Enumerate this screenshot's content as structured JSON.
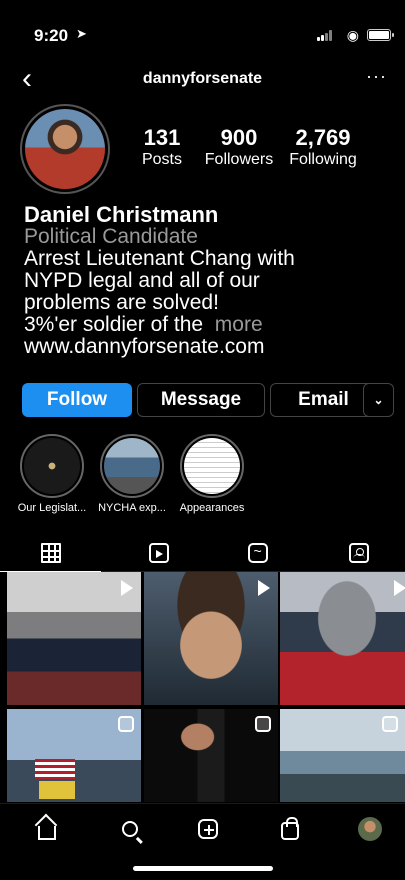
{
  "status": {
    "time": "9:20",
    "location_icon": "location-arrow-icon"
  },
  "header": {
    "back_icon": "chevron-left-icon",
    "username": "dannyforsenate",
    "more_label": "···"
  },
  "stats": {
    "posts": {
      "value": "131",
      "label": "Posts"
    },
    "followers": {
      "value": "900",
      "label": "Followers"
    },
    "following": {
      "value": "2,769",
      "label": "Following"
    }
  },
  "bio": {
    "name": "Daniel Christmann",
    "category": "Political Candidate",
    "line1": "Arrest Lieutenant Chang with",
    "line2": "NYPD legal and all of our",
    "line3": "problems are solved!",
    "line4": "3%'er soldier of the",
    "more": "more",
    "link": "www.dannyforsenate.com"
  },
  "actions": {
    "follow": "Follow",
    "message": "Message",
    "email": "Email",
    "chevron": "⌄"
  },
  "highlights": [
    {
      "label": "Our Legislat..."
    },
    {
      "label": "NYCHA exp..."
    },
    {
      "label": "Appearances"
    }
  ],
  "tabs": [
    "grid-icon",
    "reels-icon",
    "igtv-icon",
    "tagged-icon"
  ],
  "nav": [
    "home-icon",
    "search-icon",
    "new-post-icon",
    "shop-icon",
    "profile-avatar"
  ],
  "colors": {
    "accent": "#1d8ff0",
    "background": "#000000",
    "muted": "#9a9a9a"
  }
}
